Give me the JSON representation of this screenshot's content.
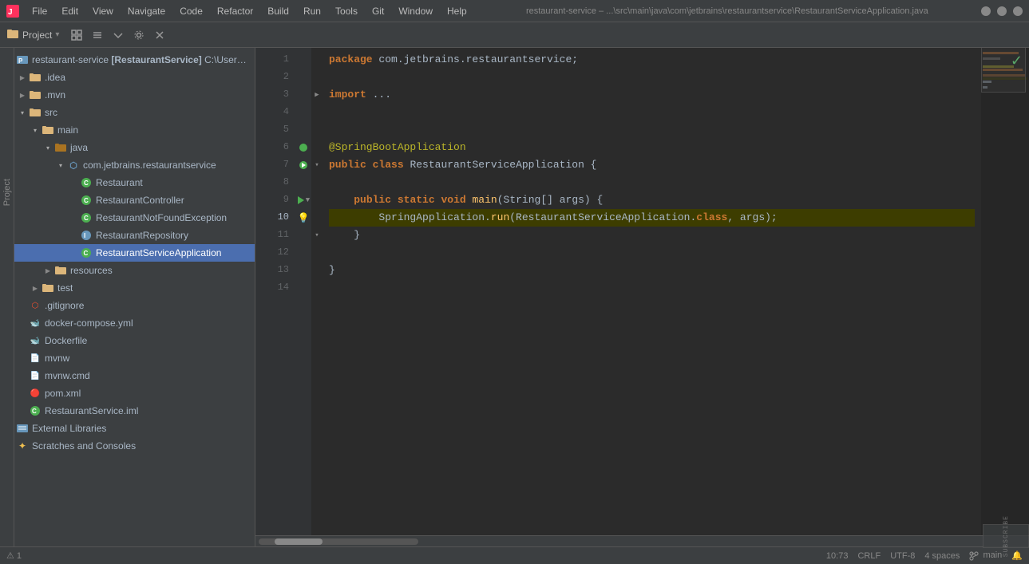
{
  "titlebar": {
    "menu_items": [
      "File",
      "Edit",
      "View",
      "Navigate",
      "Code",
      "Refactor",
      "Build",
      "Run",
      "Tools",
      "Git",
      "Window",
      "Help"
    ],
    "path": "restaurant-service – ...\\src\\main\\java\\com\\jetbrains\\restaurantservice\\RestaurantServiceApplication.java",
    "minimize_label": "─",
    "maximize_label": "□",
    "close_label": "✕"
  },
  "toolbar": {
    "project_label": "Project",
    "icons": [
      "layout-icon",
      "collapse-all-icon",
      "expand-all-icon",
      "settings-icon",
      "close-panel-icon"
    ]
  },
  "sidebar": {
    "items": [
      {
        "id": "restaurant-service",
        "label": "restaurant-service [RestaurantService] C:\\Users\\Tr",
        "indent": 0,
        "type": "project",
        "expanded": true,
        "arrow": "▾"
      },
      {
        "id": "idea",
        "label": ".idea",
        "indent": 1,
        "type": "folder",
        "expanded": false,
        "arrow": "▶"
      },
      {
        "id": "mvn",
        "label": ".mvn",
        "indent": 1,
        "type": "folder",
        "expanded": false,
        "arrow": "▶"
      },
      {
        "id": "src",
        "label": "src",
        "indent": 1,
        "type": "folder",
        "expanded": true,
        "arrow": "▾"
      },
      {
        "id": "main",
        "label": "main",
        "indent": 2,
        "type": "folder",
        "expanded": true,
        "arrow": "▾"
      },
      {
        "id": "java",
        "label": "java",
        "indent": 3,
        "type": "folder",
        "expanded": true,
        "arrow": "▾"
      },
      {
        "id": "com.jetbrains",
        "label": "com.jetbrains.restaurantservice",
        "indent": 4,
        "type": "package",
        "expanded": true,
        "arrow": "▾"
      },
      {
        "id": "Restaurant",
        "label": "Restaurant",
        "indent": 5,
        "type": "class",
        "arrow": ""
      },
      {
        "id": "RestaurantController",
        "label": "RestaurantController",
        "indent": 5,
        "type": "class",
        "arrow": ""
      },
      {
        "id": "RestaurantNotFoundException",
        "label": "RestaurantNotFoundException",
        "indent": 5,
        "type": "class-exception",
        "arrow": ""
      },
      {
        "id": "RestaurantRepository",
        "label": "RestaurantRepository",
        "indent": 5,
        "type": "interface",
        "arrow": ""
      },
      {
        "id": "RestaurantServiceApplication",
        "label": "RestaurantServiceApplication",
        "indent": 5,
        "type": "class-main",
        "arrow": "",
        "selected": true
      },
      {
        "id": "resources",
        "label": "resources",
        "indent": 3,
        "type": "folder",
        "expanded": false,
        "arrow": "▶"
      },
      {
        "id": "test",
        "label": "test",
        "indent": 2,
        "type": "folder",
        "expanded": false,
        "arrow": "▶"
      },
      {
        "id": "gitignore",
        "label": ".gitignore",
        "indent": 1,
        "type": "file-git",
        "arrow": ""
      },
      {
        "id": "docker-compose",
        "label": "docker-compose.yml",
        "indent": 1,
        "type": "file-docker",
        "arrow": ""
      },
      {
        "id": "Dockerfile",
        "label": "Dockerfile",
        "indent": 1,
        "type": "file-docker",
        "arrow": ""
      },
      {
        "id": "mvnw",
        "label": "mvnw",
        "indent": 1,
        "type": "file",
        "arrow": ""
      },
      {
        "id": "mvnw.cmd",
        "label": "mvnw.cmd",
        "indent": 1,
        "type": "file",
        "arrow": ""
      },
      {
        "id": "pom.xml",
        "label": "pom.xml",
        "indent": 1,
        "type": "file-maven",
        "arrow": ""
      },
      {
        "id": "RestaurantService.iml",
        "label": "RestaurantService.iml",
        "indent": 1,
        "type": "file-iml",
        "arrow": ""
      },
      {
        "id": "external-libraries",
        "label": "External Libraries",
        "indent": 0,
        "type": "folder-ext",
        "expanded": false,
        "arrow": "▶"
      },
      {
        "id": "scratches",
        "label": "Scratches and Consoles",
        "indent": 0,
        "type": "scratches",
        "expanded": false,
        "arrow": "▶"
      }
    ]
  },
  "editor": {
    "filename": "RestaurantServiceApplication",
    "lines": [
      {
        "num": 1,
        "text": "package com.jetbrains.restaurantservice;",
        "tokens": [
          {
            "type": "kw",
            "text": "package"
          },
          {
            "type": "normal",
            "text": " com.jetbrains.restaurantservice;"
          }
        ]
      },
      {
        "num": 2,
        "text": "",
        "tokens": []
      },
      {
        "num": 3,
        "text": "import ...;",
        "tokens": [
          {
            "type": "kw",
            "text": "import"
          },
          {
            "type": "normal",
            "text": " "
          },
          {
            "type": "comment",
            "text": "..."
          }
        ]
      },
      {
        "num": 4,
        "text": "",
        "tokens": []
      },
      {
        "num": 5,
        "text": "",
        "tokens": []
      },
      {
        "num": 6,
        "text": "@SpringBootApplication",
        "tokens": [
          {
            "type": "annotation",
            "text": "@SpringBootApplication"
          }
        ]
      },
      {
        "num": 7,
        "text": "public class RestaurantServiceApplication {",
        "tokens": [
          {
            "type": "kw",
            "text": "public"
          },
          {
            "type": "normal",
            "text": " "
          },
          {
            "type": "kw",
            "text": "class"
          },
          {
            "type": "normal",
            "text": " RestaurantServiceApplication {"
          }
        ]
      },
      {
        "num": 8,
        "text": "",
        "tokens": []
      },
      {
        "num": 9,
        "text": "    public static void main(String[] args) {",
        "tokens": [
          {
            "type": "normal",
            "text": "    "
          },
          {
            "type": "kw",
            "text": "public"
          },
          {
            "type": "normal",
            "text": " "
          },
          {
            "type": "kw",
            "text": "static"
          },
          {
            "type": "normal",
            "text": " "
          },
          {
            "type": "kw",
            "text": "void"
          },
          {
            "type": "normal",
            "text": " "
          },
          {
            "type": "method",
            "text": "main"
          },
          {
            "type": "normal",
            "text": "(String[] args) {"
          }
        ]
      },
      {
        "num": 10,
        "text": "        SpringApplication.run(RestaurantServiceApplication.class, args);",
        "highlighted": true,
        "tokens": [
          {
            "type": "normal",
            "text": "        SpringApplication."
          },
          {
            "type": "method",
            "text": "run"
          },
          {
            "type": "normal",
            "text": "(RestaurantServiceApplication."
          },
          {
            "type": "kw",
            "text": "class"
          },
          {
            "type": "normal",
            "text": ", args);"
          }
        ]
      },
      {
        "num": 11,
        "text": "    }",
        "tokens": [
          {
            "type": "normal",
            "text": "    }"
          }
        ]
      },
      {
        "num": 12,
        "text": "",
        "tokens": []
      },
      {
        "num": 13,
        "text": "}",
        "tokens": [
          {
            "type": "normal",
            "text": "}"
          }
        ]
      },
      {
        "num": 14,
        "text": "",
        "tokens": []
      }
    ]
  },
  "statusbar": {
    "position": "10:73",
    "line_separator": "CRLF",
    "encoding": "UTF-8",
    "indent": "4 spaces",
    "branch": "main",
    "warnings": "⚠",
    "git_icon": "↑"
  },
  "icons": {
    "folder": "📁",
    "package": "📦",
    "class": "C",
    "interface": "I",
    "file": "📄",
    "project": "🏗"
  }
}
